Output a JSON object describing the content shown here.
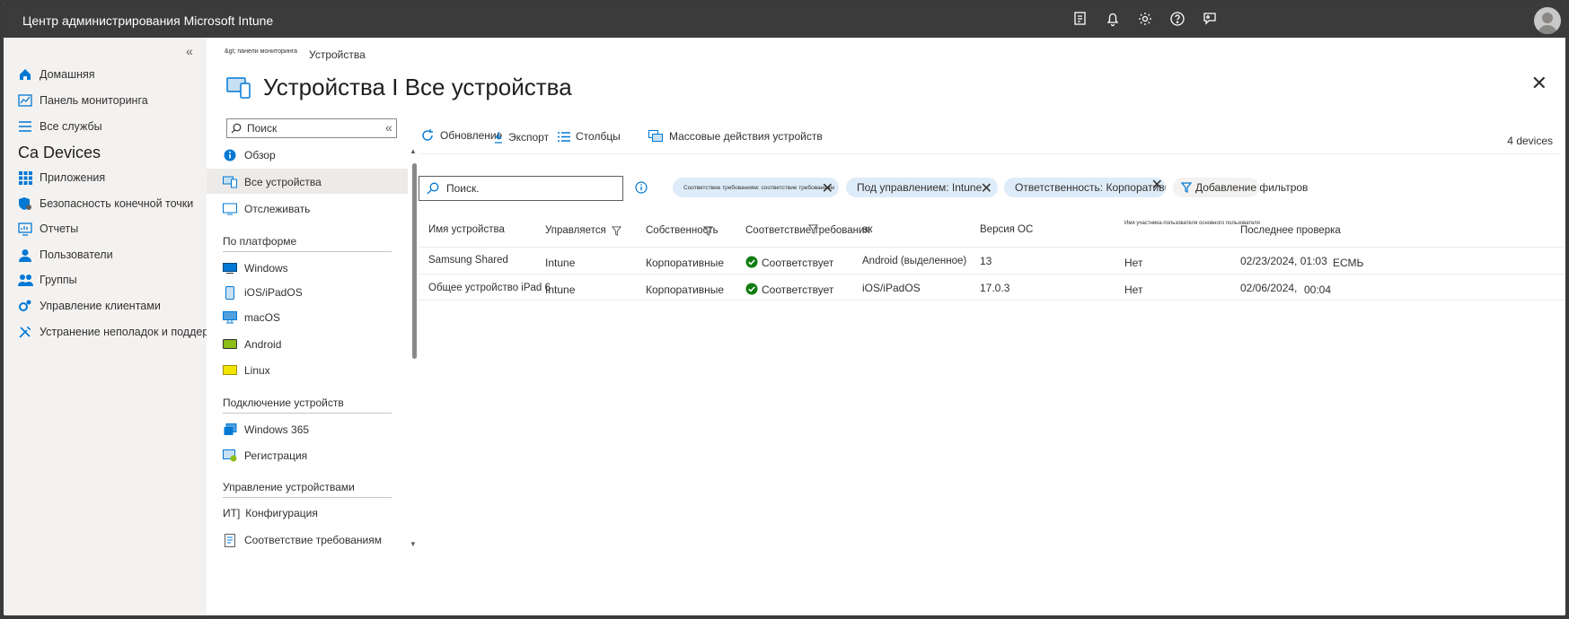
{
  "app": {
    "title": "Центр администрирования Microsoft Intune"
  },
  "topbar_icons": [
    "feedback-icon",
    "bell-icon",
    "gear-icon",
    "help-icon",
    "chat-icon"
  ],
  "leftnav": {
    "collapse": "«",
    "items": [
      {
        "label": "Домашняя",
        "icon": "home-icon"
      },
      {
        "label": "Панель мониторинга",
        "icon": "dashboard-icon"
      },
      {
        "label": "Все службы",
        "icon": "list-icon"
      }
    ],
    "section_title": "Ca Devices",
    "items2": [
      {
        "label": "Приложения",
        "icon": "apps-icon"
      },
      {
        "label": "Безопасность конечной точки",
        "icon": "shield-icon"
      },
      {
        "label": "Отчеты",
        "icon": "reports-icon"
      },
      {
        "label": "Пользователи",
        "icon": "user-icon"
      },
      {
        "label": "Группы",
        "icon": "groups-icon"
      },
      {
        "label": "Управление клиентами",
        "icon": "tenant-icon"
      },
      {
        "label": "Устранение неполадок и поддержка",
        "icon": "wrench-icon"
      }
    ]
  },
  "breadcrumb": {
    "prefix": "&gt; панели мониторинга",
    "current": "Устройства"
  },
  "page": {
    "title": "Устройства I Все устройства"
  },
  "sidemenu": {
    "search_placeholder": "Поиск",
    "collapse": "«",
    "top_items": [
      {
        "label": "Обзор",
        "icon": "info-icon"
      },
      {
        "label": "Все устройства",
        "icon": "devices-icon"
      },
      {
        "label": "Отслеживать",
        "icon": "monitor-icon"
      }
    ],
    "platform_title": "По платформе",
    "platform_items": [
      {
        "label": "Windows",
        "icon": "windows-icon"
      },
      {
        "label": "iOS/iPadOS",
        "icon": "ios-icon"
      },
      {
        "label": "macOS",
        "icon": "macos-icon"
      },
      {
        "label": "Android",
        "icon": "android-icon"
      },
      {
        "label": "Linux",
        "icon": "linux-icon"
      }
    ],
    "onboard_title": "Подключение устройств",
    "onboard_items": [
      {
        "label": "Windows 365",
        "icon": "windows365-icon"
      },
      {
        "label": "Регистрация",
        "icon": "enroll-icon"
      }
    ],
    "manage_title": "Управление устройствами",
    "manage_items": [
      {
        "label": "Конфигурация",
        "prefix": "ИТ]",
        "icon": "config-icon"
      },
      {
        "label": "Соответствие требованиям",
        "icon": "compliance-icon"
      }
    ]
  },
  "toolbar": {
    "refresh": "Обновление",
    "export": "Экспорт",
    "columns": "Столбцы",
    "bulk": "Массовые действия устройств",
    "count_num": "4",
    "count_label": "devices"
  },
  "search": {
    "placeholder": "Поиск."
  },
  "filters": [
    {
      "label": "Соответствие требованиям: соответствие требованиям"
    },
    {
      "label": "Под управлением: Intune"
    },
    {
      "label": "Ответственность: Корпоративная"
    }
  ],
  "add_filter": "Добавление фильтров",
  "table": {
    "columns": [
      "Имя устройства",
      "Управляется",
      "Собственность",
      "Соответствие требования",
      "ак",
      "Версия ОС",
      "Имя участника-пользователя основного пользователя",
      "Последнее проверка"
    ],
    "rows": [
      {
        "name": "Samsung Shared",
        "managed": "Intune",
        "ownership": "Корпоративные",
        "compliance": "Соответствует",
        "os": "Android (выделенное)",
        "version": "13",
        "upn": "Нет",
        "last_date": "02/23/2024, 01:03",
        "last_time": "ЕСМЬ"
      },
      {
        "name": "Общее устройство iPad 6",
        "managed": "Intune",
        "ownership": "Корпоративные",
        "compliance": "Соответствует",
        "os": "iOS/iPadOS",
        "version": "17.0.3",
        "upn": "Нет",
        "last_date": "02/06/2024,",
        "last_time": "00:04"
      }
    ]
  },
  "colors": {
    "topbar": "#3b3b3b",
    "nav": "#f3f2f1",
    "accent": "#0078d4",
    "pill": "#deecf9",
    "ok": "#107c10"
  }
}
